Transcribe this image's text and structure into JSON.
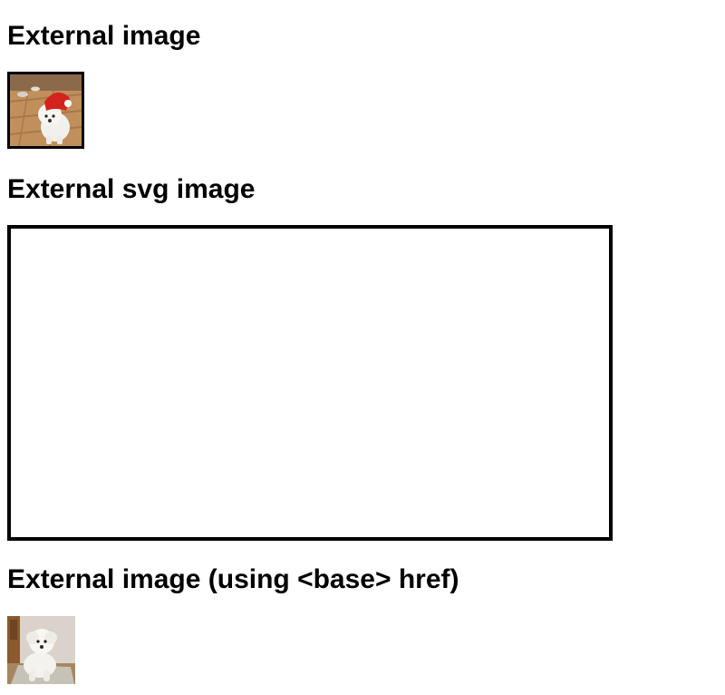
{
  "sections": [
    {
      "heading": "External image",
      "icon": "dog-in-red-hat-photo"
    },
    {
      "heading": "External svg image",
      "icon": "blank-svg-frame"
    },
    {
      "heading": "External image (using <base> href)",
      "icon": "white-dog-photo"
    }
  ],
  "colors": {
    "text": "#000000",
    "background": "#ffffff",
    "border": "#000000"
  }
}
